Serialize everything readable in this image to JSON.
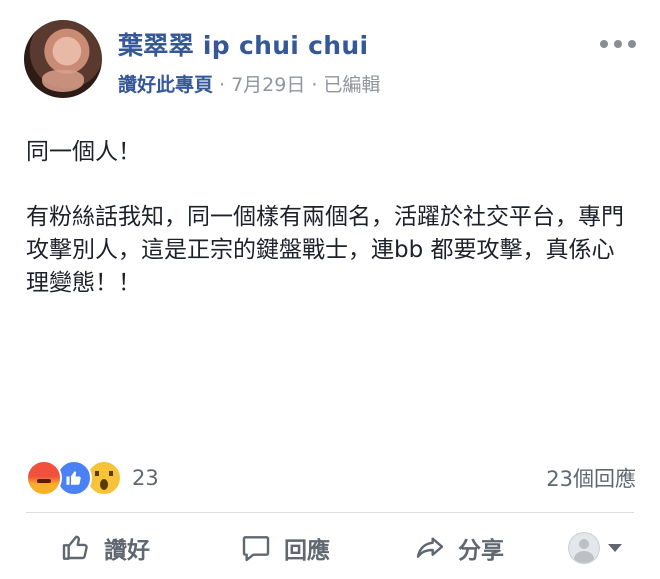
{
  "post": {
    "page_name": "葉翠翠 ip chui chui",
    "like_page": "讚好此專頁",
    "separator": "·",
    "date": "7月29日",
    "edited": "已編輯",
    "body_line1": "同一個人！",
    "body_para2": "有粉絲話我知，同一個樣有兩個名，活躍於社交平台，專門攻擊別人，這是正宗的鍵盤戰士，連bb 都要攻擊，真係心理變態！！"
  },
  "reactions": {
    "icons": [
      "angry-icon",
      "like-icon",
      "wow-icon"
    ],
    "count": "23",
    "comments": "23個回應"
  },
  "actions": {
    "like": "讚好",
    "comment": "回應",
    "share": "分享"
  },
  "colors": {
    "link": "#365899",
    "meta": "#90949c",
    "text": "#1d2129",
    "action": "#606770"
  }
}
